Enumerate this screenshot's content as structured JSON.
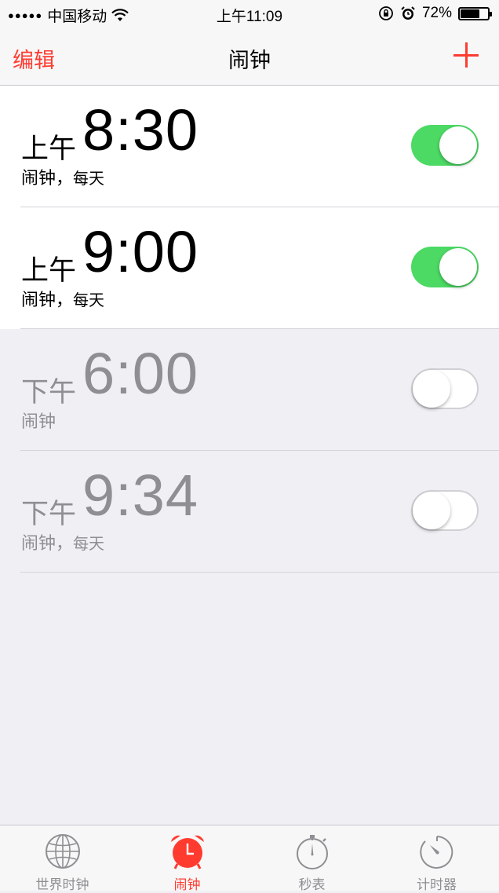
{
  "status_bar": {
    "signal": "●●●●●",
    "carrier": "中国移动",
    "time": "上午11:09",
    "battery": "72%",
    "battery_level": 0.72
  },
  "nav": {
    "edit_label": "编辑",
    "title": "闹钟",
    "add_icon": "plus-icon"
  },
  "alarms": [
    {
      "ampm": "上午",
      "time": "8:30",
      "label": "闹钟，",
      "repeat": "每天",
      "enabled": true
    },
    {
      "ampm": "上午",
      "time": "9:00",
      "label": "闹钟，",
      "repeat": "每天",
      "enabled": true
    },
    {
      "ampm": "下午",
      "time": "6:00",
      "label": "闹钟",
      "repeat": "",
      "enabled": false
    },
    {
      "ampm": "下午",
      "time": "9:34",
      "label": "闹钟，",
      "repeat": "每天",
      "enabled": false
    }
  ],
  "tabs": [
    {
      "label": "世界时钟",
      "icon": "globe-icon",
      "active": false
    },
    {
      "label": "闹钟",
      "icon": "alarm-clock-icon",
      "active": true
    },
    {
      "label": "秒表",
      "icon": "stopwatch-icon",
      "active": false
    },
    {
      "label": "计时器",
      "icon": "timer-icon",
      "active": false
    }
  ],
  "colors": {
    "accent": "#ff3b30",
    "toggle_on": "#4cd964",
    "disabled_text": "#8e8e93"
  }
}
